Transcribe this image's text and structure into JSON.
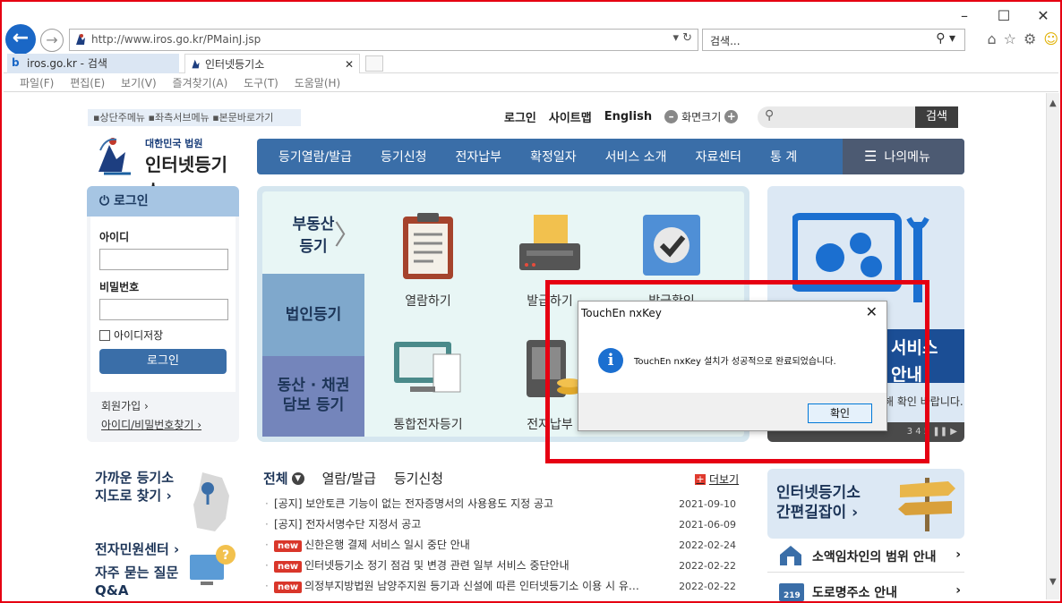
{
  "browser": {
    "url": "http://www.iros.go.kr/PMainJ.jsp",
    "search_placeholder": "검색...",
    "tabs": [
      {
        "label": "iros.go.kr - 검색"
      },
      {
        "label": "인터넷등기소"
      }
    ],
    "menu": [
      "파일(F)",
      "편집(E)",
      "보기(V)",
      "즐겨찾기(A)",
      "도구(T)",
      "도움말(H)"
    ]
  },
  "site": {
    "skip_links": "▪상단주메뉴 ▪좌측서브메뉴 ▪본문바로가기",
    "top_links": [
      "로그인",
      "사이트맵",
      "English"
    ],
    "zoom_label": "화면크기",
    "search_button": "검색",
    "logo_small": "대한민국 법원",
    "logo_big": "인터넷등기소",
    "gnb": [
      "등기열람/발급",
      "등기신청",
      "전자납부",
      "확정일자",
      "서비스 소개",
      "자료센터",
      "통 계"
    ],
    "my_menu": "나의메뉴"
  },
  "login": {
    "header": "로그인",
    "id_label": "아이디",
    "pw_label": "비밀번호",
    "save_id": "아이디저장",
    "button": "로그인",
    "join": "회원가입 ›",
    "find": "아이디/비밀번호찾기 ›"
  },
  "center": {
    "tab_real_estate": "부동산\n등기",
    "tab_real_estate_l1": "부동산",
    "tab_real_estate_l2": "등기",
    "tab_corp": "법인등기",
    "tab_movable_l1": "동산 · 채권",
    "tab_movable_l2": "담보 등기",
    "services": [
      "열람하기",
      "발급하기",
      "발급확인",
      "통합전자등기",
      "전자납부"
    ]
  },
  "banner": {
    "title1": "서비스",
    "title2": "안내",
    "note": "해 확인 바랍니다.",
    "pager": "3 4 5"
  },
  "lower": {
    "find_office_l1": "가까운 등기소",
    "find_office_l2": "지도로 찾기 ›",
    "civil_center": "전자민원센터 ›",
    "faq_l1": "자주 묻는 질문",
    "faq_l2": "Q&A",
    "news_tabs": [
      "전체",
      "열람/발급",
      "등기신청"
    ],
    "more": "더보기",
    "news": [
      {
        "badge": "",
        "title": "[공지] 보안토큰 기능이 없는 전자증명서의 사용용도 지정 공고",
        "date": "2021-09-10"
      },
      {
        "badge": "",
        "title": "[공지] 전자서명수단 지정서 공고",
        "date": "2021-06-09"
      },
      {
        "badge": "new",
        "title": "신한은행 결제 서비스 일시 중단 안내",
        "date": "2022-02-24"
      },
      {
        "badge": "new",
        "title": "인터넷등기소 정기 점검 및 변경 관련 일부 서비스 중단안내",
        "date": "2022-02-22"
      },
      {
        "badge": "new",
        "title": "의정부지방법원 남양주지원 등기과 신설에 따른 인터넷등기소 이용 시 유…",
        "date": "2022-02-22"
      }
    ],
    "guide_l1": "인터넷등기소",
    "guide_l2": "간편길잡이",
    "rows": [
      "소액임차인의 범위 안내",
      "도로명주소 안내"
    ]
  },
  "dialog": {
    "title": "TouchEn nxKey",
    "message": "TouchEn nxKey 설치가 성공적으로 완료되었습니다.",
    "ok": "확인"
  }
}
